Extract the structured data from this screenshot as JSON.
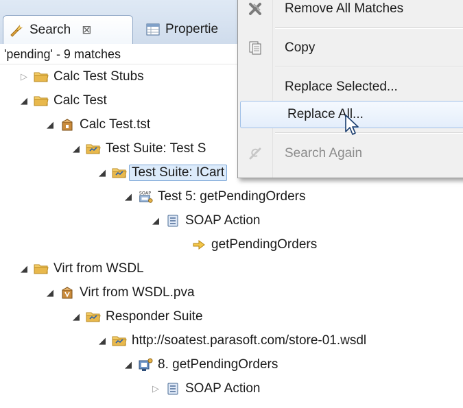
{
  "tabs": [
    {
      "label": "Search",
      "icon": "search-flashlight-icon",
      "close": "⊠",
      "active": true
    },
    {
      "label": "Propertie",
      "icon": "properties-table-icon",
      "active": false
    }
  ],
  "status": "'pending' - 9 matches",
  "tree": [
    {
      "label": "Calc Test Stubs",
      "icon": "folder-icon",
      "expanded": false
    },
    {
      "label": "Calc Test",
      "icon": "folder-icon",
      "expanded": true
    },
    {
      "label": "Calc Test.tst",
      "icon": "test-file-icon",
      "expanded": true
    },
    {
      "label": "Test Suite: Test S",
      "icon": "test-suite-icon",
      "expanded": true
    },
    {
      "label": "Test Suite: ICart",
      "icon": "test-suite-icon",
      "expanded": true,
      "selected": true
    },
    {
      "label": "Test 5: getPendingOrders",
      "icon": "soap-client-icon",
      "expanded": true
    },
    {
      "label": "SOAP Action",
      "icon": "document-icon",
      "expanded": true
    },
    {
      "label": "getPendingOrders",
      "icon": "arrow-match-icon",
      "leaf": true
    },
    {
      "label": "Virt from WSDL",
      "icon": "folder-icon",
      "expanded": true
    },
    {
      "label": "Virt from WSDL.pva",
      "icon": "virtual-asset-file-icon",
      "expanded": true
    },
    {
      "label": "Responder Suite",
      "icon": "test-suite-icon",
      "expanded": true
    },
    {
      "label": "http://soatest.parasoft.com/store-01.wsdl",
      "icon": "test-suite-icon",
      "expanded": true
    },
    {
      "label": "8. getPendingOrders",
      "icon": "responder-icon",
      "expanded": true
    },
    {
      "label": "SOAP Action",
      "icon": "document-icon",
      "expanded": false
    }
  ],
  "menu": {
    "items": [
      {
        "label": "Remove All Matches",
        "icon": "remove-all-icon",
        "enabled": true
      },
      {
        "label": "Copy",
        "icon": "copy-icon",
        "enabled": true
      },
      {
        "label": "Replace Selected...",
        "enabled": true
      },
      {
        "label": "Replace All...",
        "enabled": true,
        "hovered": true
      },
      {
        "label": "Search Again",
        "icon": "search-again-icon",
        "enabled": false
      }
    ]
  },
  "colors": {
    "tab_strip": "#dfe9f5",
    "selection": "#dcebfb",
    "menu_hover": "#e4eefb",
    "folder": "#e8b84c",
    "disabled_text": "#8c8c8c"
  }
}
